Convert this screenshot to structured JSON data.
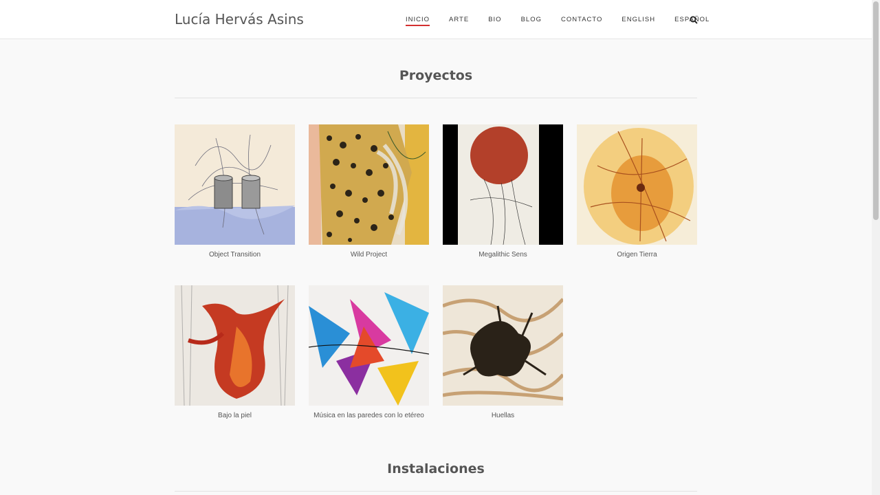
{
  "site": {
    "title": "Lucía Hervás Asins"
  },
  "nav": {
    "items": [
      {
        "label": "INICIO",
        "active": true
      },
      {
        "label": "ARTE"
      },
      {
        "label": "BIO"
      },
      {
        "label": "BLOG"
      },
      {
        "label": "CONTACTO"
      },
      {
        "label": "ENGLISH"
      },
      {
        "label": "ESPAÑOL"
      }
    ],
    "search_icon": "search-icon"
  },
  "sections": {
    "projects": {
      "title": "Proyectos",
      "items": [
        {
          "caption": "Object Transition"
        },
        {
          "caption": "Wild Project"
        },
        {
          "caption": "Megalithic Sens"
        },
        {
          "caption": "Origen Tierra"
        },
        {
          "caption": "Bajo la piel"
        },
        {
          "caption": "Música en las paredes con lo etéreo"
        },
        {
          "caption": "Huellas"
        }
      ]
    },
    "installations": {
      "title": "Instalaciones"
    }
  },
  "colors": {
    "accent": "#d32f2f",
    "background": "#f9f9f9",
    "header_bg": "#ffffff"
  }
}
